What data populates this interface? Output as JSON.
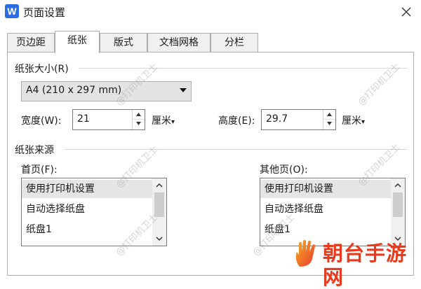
{
  "window": {
    "title": "页面设置",
    "app_icon_letter": "W"
  },
  "tabs": [
    {
      "label": "页边距",
      "active": false
    },
    {
      "label": "纸张",
      "active": true
    },
    {
      "label": "版式",
      "active": false
    },
    {
      "label": "文档网格",
      "active": false
    },
    {
      "label": "分栏",
      "active": false
    }
  ],
  "paper_size": {
    "section_label": "纸张大小(R)",
    "selected": "A4 (210 x 297 mm)",
    "width_label": "宽度(W):",
    "width_value": "21",
    "width_unit": "厘米",
    "height_label": "高度(E):",
    "height_value": "29.7",
    "height_unit": "厘米"
  },
  "paper_source": {
    "section_label": "纸张来源",
    "first_page_label": "首页(F):",
    "other_pages_label": "其他页(O):",
    "first_page_items": [
      "使用打印机设置",
      "自动选择纸盘",
      "纸盘1"
    ],
    "other_pages_items": [
      "使用打印机设置",
      "自动选择纸盘",
      "纸盘1"
    ]
  },
  "watermark_text": "@打印机卫士",
  "brand": {
    "text": "朝台手游网",
    "color": "#e83a1c"
  },
  "colors": {
    "accent": "#2b6de5",
    "selected_row": "#e5e5e5"
  }
}
